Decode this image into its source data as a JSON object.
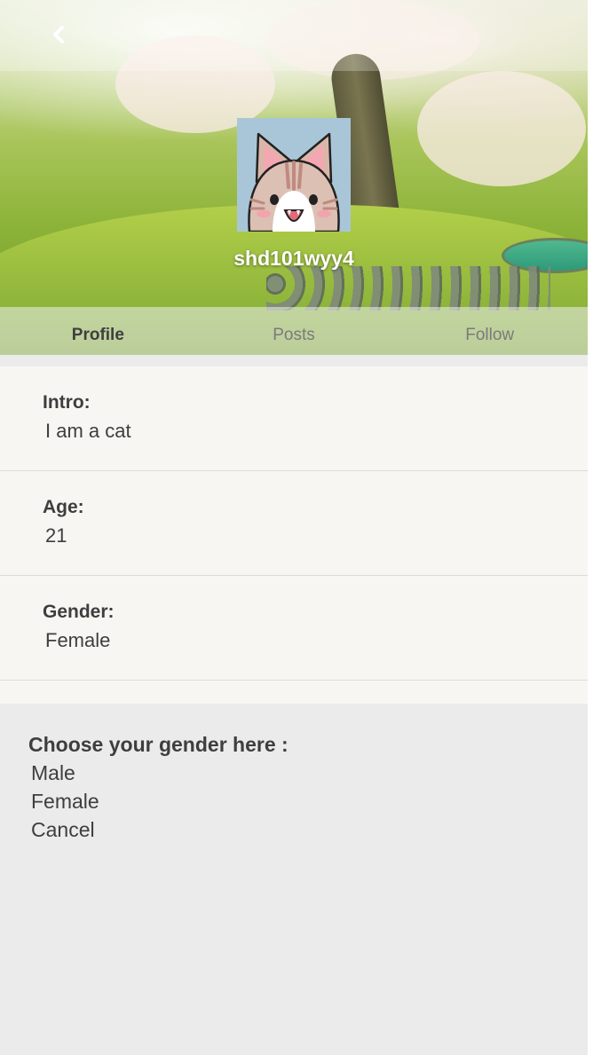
{
  "header": {
    "back_icon": "chevron-left-icon",
    "username": "shd101wyy4",
    "avatar": "cat-avatar"
  },
  "tabs": [
    {
      "label": "Profile",
      "active": true
    },
    {
      "label": "Posts",
      "active": false
    },
    {
      "label": "Follow",
      "active": false
    }
  ],
  "profile": {
    "intro": {
      "label": "Intro:",
      "value": "I am a cat"
    },
    "age": {
      "label": "Age:",
      "value": "21"
    },
    "gender": {
      "label": "Gender:",
      "value": "Female"
    }
  },
  "gender_picker": {
    "title": "Choose your gender here :",
    "options": [
      "Male",
      "Female",
      "Cancel"
    ]
  },
  "colors": {
    "text": "#3e3e3e",
    "tab_inactive": "#7a7a7a",
    "content_bg": "#f7f6f3",
    "sheet_bg": "#ebebeb",
    "avatar_bg": "#a9c6d8"
  }
}
